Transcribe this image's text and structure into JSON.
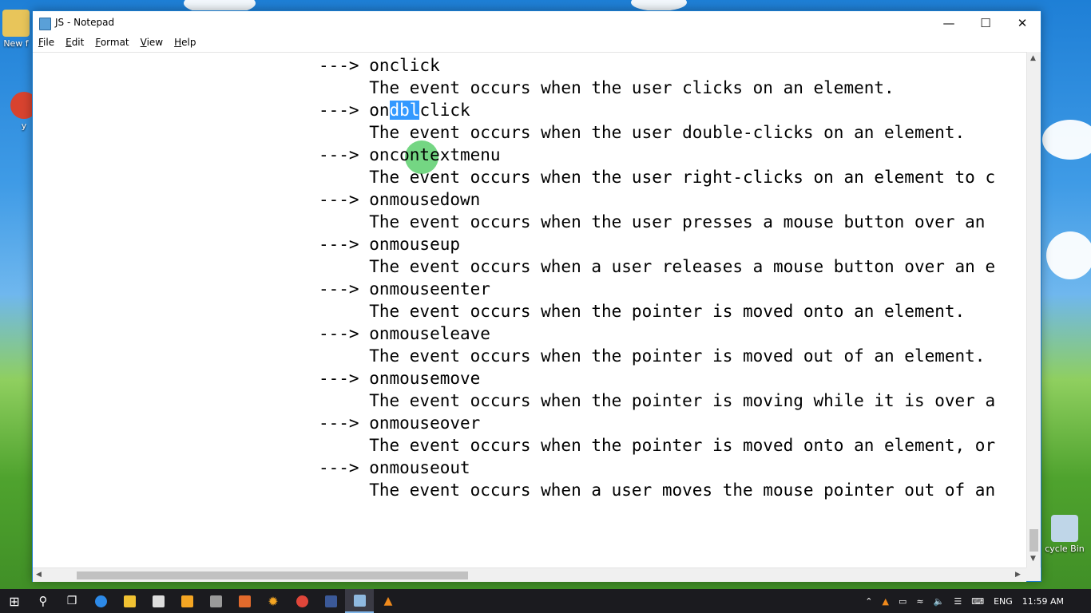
{
  "window": {
    "title": "JS - Notepad",
    "controls": {
      "minimize": "—",
      "maximize": "☐",
      "close": "✕"
    }
  },
  "menu": [
    {
      "label": "File",
      "underline": "F",
      "rest": "ile"
    },
    {
      "label": "Edit",
      "underline": "E",
      "rest": "dit"
    },
    {
      "label": "Format",
      "underline": "F",
      "rest": "ormat"
    },
    {
      "label": "View",
      "underline": "V",
      "rest": "iew"
    },
    {
      "label": "Help",
      "underline": "H",
      "rest": "elp"
    }
  ],
  "editor": {
    "lines": [
      "---> onclick",
      "     The event occurs when the user clicks on an element.",
      "---> ondblclick",
      "     The event occurs when the user double-clicks on an element.",
      "---> oncontextmenu",
      "     The event occurs when the user right-clicks on an element to c",
      "---> onmousedown",
      "     The event occurs when the user presses a mouse button over an",
      "---> onmouseup",
      "     The event occurs when a user releases a mouse button over an e",
      "---> onmouseenter",
      "     The event occurs when the pointer is moved onto an element.",
      "---> onmouseleave",
      "     The event occurs when the pointer is moved out of an element.",
      "---> onmousemove",
      "     The event occurs when the pointer is moving while it is over a",
      "---> onmouseover",
      "     The event occurs when the pointer is moved onto an element, or",
      "---> onmouseout",
      "     The event occurs when a user moves the mouse pointer out of an"
    ],
    "selection": {
      "line_index": 2,
      "before": "---> on",
      "selected": "dbl",
      "after": "click"
    }
  },
  "desktop": {
    "icons": [
      {
        "label": "New f",
        "color": "#e8c55a"
      },
      {
        "label": "y",
        "color": "#d8432f"
      },
      {
        "label": "cycle Bin",
        "color": "#bfd6e8"
      }
    ]
  },
  "taskbar": {
    "apps": [
      {
        "name": "start-button",
        "glyph": "⊞",
        "color": "#ffffff"
      },
      {
        "name": "search-icon",
        "glyph": "⚲",
        "color": "#ffffff"
      },
      {
        "name": "task-view-icon",
        "glyph": "❐",
        "color": "#ffffff"
      },
      {
        "name": "edge-icon",
        "glyph": "e",
        "color": "#2d8ae8"
      },
      {
        "name": "file-explorer-icon",
        "glyph": "",
        "color": "#f1c232"
      },
      {
        "name": "store-icon",
        "glyph": "",
        "color": "#dddddd"
      },
      {
        "name": "media-player-icon",
        "glyph": "",
        "color": "#f5a623"
      },
      {
        "name": "film-icon",
        "glyph": "",
        "color": "#9a9a9a"
      },
      {
        "name": "fox-icon",
        "glyph": "",
        "color": "#e26a2c"
      },
      {
        "name": "spark-icon",
        "glyph": "✹",
        "color": "#f5a623"
      },
      {
        "name": "chrome-icon",
        "glyph": "",
        "color": "#e0463a"
      },
      {
        "name": "facebook-icon",
        "glyph": "f",
        "color": "#3b5998"
      },
      {
        "name": "notepad-icon",
        "glyph": "",
        "color": "#8fb9e0"
      },
      {
        "name": "vlc-icon",
        "glyph": "▲",
        "color": "#f08a1c"
      }
    ],
    "tray": {
      "language": "ENG",
      "time": "11:59 AM"
    }
  }
}
